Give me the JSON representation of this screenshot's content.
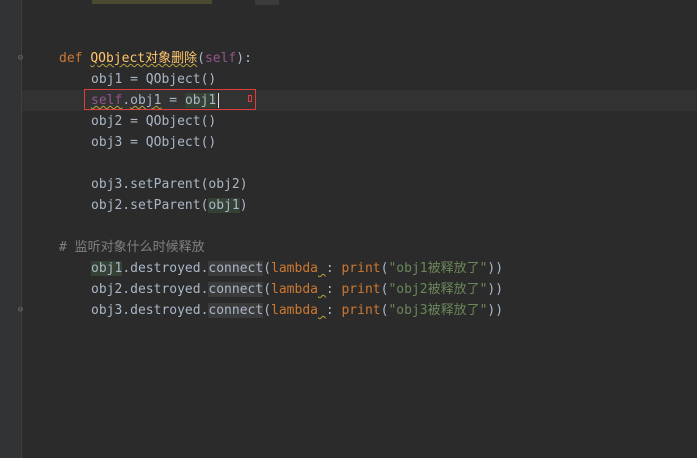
{
  "editor": {
    "lines": [
      {
        "id": "def",
        "tokens": [
          {
            "t": "def ",
            "c": "kw"
          },
          {
            "t": "QObject对象删除",
            "c": "fn squig"
          },
          {
            "t": "(",
            "c": ""
          },
          {
            "t": "self",
            "c": "self"
          },
          {
            "t": "):",
            "c": ""
          }
        ]
      },
      {
        "id": "obj1",
        "tokens": [
          {
            "t": "obj1 = QObject()",
            "c": ""
          }
        ]
      },
      {
        "id": "selfobj1",
        "tokens": [
          {
            "t": "self",
            "c": "self squig"
          },
          {
            "t": ".",
            "c": ""
          },
          {
            "t": "obj1",
            "c": "squig"
          },
          {
            "t": " = ",
            "c": ""
          },
          {
            "t": "obj1",
            "c": "hl"
          }
        ]
      },
      {
        "id": "obj2",
        "tokens": [
          {
            "t": "obj2 = QObject()",
            "c": ""
          }
        ]
      },
      {
        "id": "obj3",
        "tokens": [
          {
            "t": "obj3 = QObject()",
            "c": ""
          }
        ]
      },
      {
        "id": "setparent3",
        "tokens": [
          {
            "t": "obj3.setParent(obj2)",
            "c": ""
          }
        ]
      },
      {
        "id": "setparent2",
        "tokens": [
          {
            "t": "obj2.setParent(",
            "c": ""
          },
          {
            "t": "obj1",
            "c": "hl"
          },
          {
            "t": ")",
            "c": ""
          }
        ]
      },
      {
        "id": "comment",
        "tokens": [
          {
            "t": "# 监听对象什么时候释放",
            "c": "cmt"
          }
        ]
      },
      {
        "id": "destroyed1",
        "tokens": [
          {
            "t": "obj1",
            "c": "hl"
          },
          {
            "t": ".destroyed.",
            "c": ""
          },
          {
            "t": "connect",
            "c": "hl2"
          },
          {
            "t": "(",
            "c": ""
          },
          {
            "t": "lambda",
            "c": "kw"
          },
          {
            "t": " ",
            "c": "squig"
          },
          {
            "t": ": ",
            "c": ""
          },
          {
            "t": "print",
            "c": "kw"
          },
          {
            "t": "(",
            "c": ""
          },
          {
            "t": "\"obj1被释放了\"",
            "c": "str"
          },
          {
            "t": "))",
            "c": ""
          }
        ]
      },
      {
        "id": "destroyed2",
        "tokens": [
          {
            "t": "obj2.destroyed.",
            "c": ""
          },
          {
            "t": "connect",
            "c": "hl2"
          },
          {
            "t": "(",
            "c": ""
          },
          {
            "t": "lambda",
            "c": "kw"
          },
          {
            "t": " ",
            "c": "squig"
          },
          {
            "t": ": ",
            "c": ""
          },
          {
            "t": "print",
            "c": "kw"
          },
          {
            "t": "(",
            "c": ""
          },
          {
            "t": "\"obj2被释放了\"",
            "c": "str"
          },
          {
            "t": "))",
            "c": ""
          }
        ]
      },
      {
        "id": "destroyed3",
        "tokens": [
          {
            "t": "obj3.destroyed.",
            "c": ""
          },
          {
            "t": "connect",
            "c": "hl2"
          },
          {
            "t": "(",
            "c": ""
          },
          {
            "t": "lambda",
            "c": "kw"
          },
          {
            "t": " ",
            "c": "squig"
          },
          {
            "t": ": ",
            "c": ""
          },
          {
            "t": "print",
            "c": "kw"
          },
          {
            "t": "(",
            "c": ""
          },
          {
            "t": "\"obj3被释放了\"",
            "c": "str"
          },
          {
            "t": "))",
            "c": ""
          }
        ]
      }
    ]
  },
  "colors": {
    "background": "#2b2b2b",
    "keyword": "#cc7832",
    "function": "#ffc66d",
    "self": "#94558d",
    "string": "#6a8759",
    "comment": "#808080",
    "text": "#a9b7c6",
    "selection_box": "#e03c3c"
  }
}
